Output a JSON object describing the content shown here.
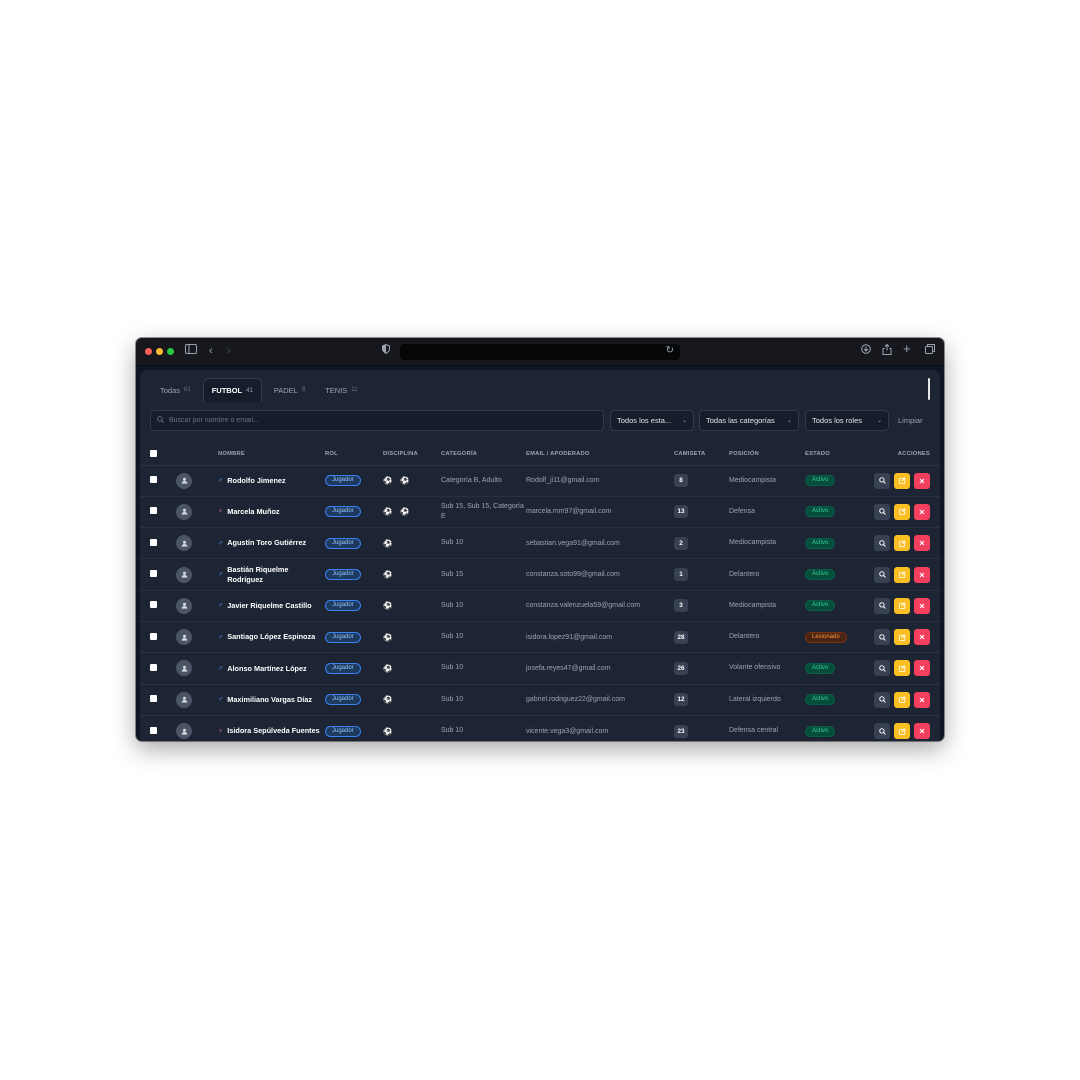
{
  "browser": {
    "title_bar_icons": [
      "sidebar-icon",
      "back-icon",
      "forward-icon",
      "shield-icon",
      "reload-icon",
      "download-icon",
      "share-icon",
      "new-tab-icon",
      "tabs-overview-icon"
    ]
  },
  "tabs": [
    {
      "label": "Todas",
      "count": "61",
      "active": false
    },
    {
      "label": "FUTBOL",
      "count": "41",
      "active": true
    },
    {
      "label": "PADEL",
      "count": "8",
      "active": false
    },
    {
      "label": "TENIS",
      "count": "11",
      "active": false
    }
  ],
  "filters": {
    "search_placeholder": "Buscar por nombre o email...",
    "estado": "Todos los esta...",
    "categoria": "Todas las categorías",
    "rol": "Todos los roles",
    "clear_label": "Limpiar"
  },
  "table": {
    "headers": {
      "nombre": "NOMBRE",
      "rol": "ROL",
      "disciplina": "DISCIPLINA",
      "categoria": "CATEGORÍA",
      "email": "EMAIL / APODERADO",
      "camiseta": "CAMISETA",
      "posicion": "POSICIÓN",
      "estado": "ESTADO",
      "acciones": "ACCIONES"
    },
    "rows": [
      {
        "gender": "♂",
        "gender_type": "m",
        "name": "Rodolfo Jimenez",
        "rol": "Jugador",
        "disciplina": "⚽ ⚽",
        "categoria": "Categoría B, Adulto",
        "email": "Rodolf_ji11@gmail.com",
        "camiseta": "8",
        "posicion": "Mediocampista",
        "estado": "Activo",
        "estado_type": "activo"
      },
      {
        "gender": "♀",
        "gender_type": "f",
        "name": "Marcela Muñoz",
        "rol": "Jugador",
        "disciplina": "⚽ ⚽",
        "categoria": "Sub 15, Sub 15, Categoría E",
        "email": "marcela.mm97@gmail.com",
        "camiseta": "13",
        "posicion": "Defensa",
        "estado": "Activo",
        "estado_type": "activo"
      },
      {
        "gender": "♂",
        "gender_type": "m",
        "name": "Agustín Toro Gutiérrez",
        "rol": "Jugador",
        "disciplina": "⚽",
        "categoria": "Sub 10",
        "email": "sebastian.vega91@gmail.com",
        "camiseta": "2",
        "posicion": "Mediocampista",
        "estado": "Activo",
        "estado_type": "activo"
      },
      {
        "gender": "♂",
        "gender_type": "m",
        "name": "Bastián Riquelme Rodríguez",
        "rol": "Jugador",
        "disciplina": "⚽",
        "categoria": "Sub 15",
        "email": "constanza.soto99@gmail.com",
        "camiseta": "1",
        "posicion": "Delantero",
        "estado": "Activo",
        "estado_type": "activo"
      },
      {
        "gender": "♂",
        "gender_type": "m",
        "name": "Javier Riquelme Castillo",
        "rol": "Jugador",
        "disciplina": "⚽",
        "categoria": "Sub 10",
        "email": "constanza.valenzuela59@gmail.com",
        "camiseta": "3",
        "posicion": "Mediocampista",
        "estado": "Activo",
        "estado_type": "activo"
      },
      {
        "gender": "♂",
        "gender_type": "m",
        "name": "Santiago López Espinoza",
        "rol": "Jugador",
        "disciplina": "⚽",
        "categoria": "Sub 10",
        "email": "isidora.lopez91@gmail.com",
        "camiseta": "28",
        "posicion": "Delantero",
        "estado": "Lesionado",
        "estado_type": "lesionado"
      },
      {
        "gender": "♂",
        "gender_type": "m",
        "name": "Alonso Martínez López",
        "rol": "Jugador",
        "disciplina": "⚽",
        "categoria": "Sub 10",
        "email": "josefa.reyes47@gmail.com",
        "camiseta": "26",
        "posicion": "Volante ofensivo",
        "estado": "Activo",
        "estado_type": "activo"
      },
      {
        "gender": "♂",
        "gender_type": "m",
        "name": "Maximiliano Vargas Díaz",
        "rol": "Jugador",
        "disciplina": "⚽",
        "categoria": "Sub 10",
        "email": "gabriel.rodriguez22@gmail.com",
        "camiseta": "12",
        "posicion": "Lateral izquierdo",
        "estado": "Activo",
        "estado_type": "activo"
      },
      {
        "gender": "♀",
        "gender_type": "f",
        "name": "Isidora Sepúlveda Fuentes",
        "rol": "Jugador",
        "disciplina": "⚽",
        "categoria": "Sub 10",
        "email": "vicente.vega3@gmail.com",
        "camiseta": "23",
        "posicion": "Defensa central",
        "estado": "Activo",
        "estado_type": "activo"
      }
    ]
  }
}
